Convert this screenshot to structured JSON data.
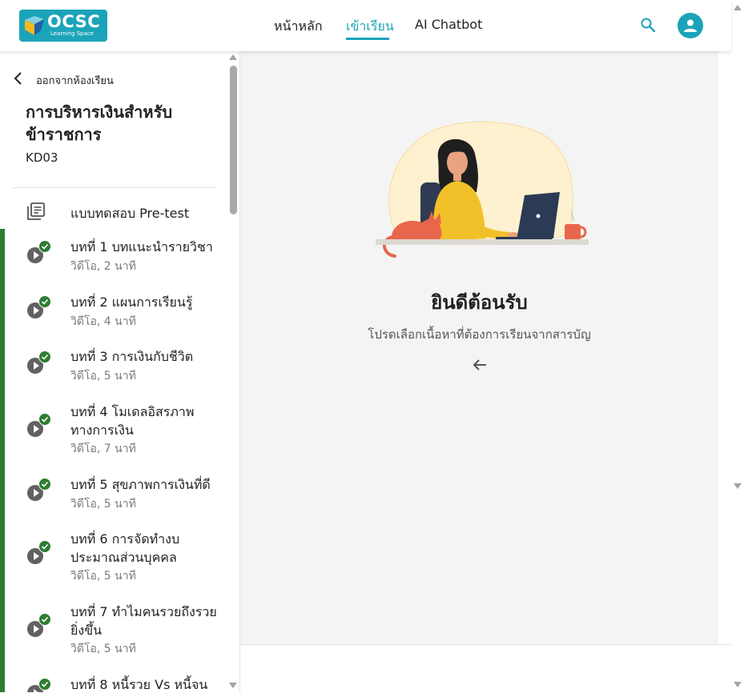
{
  "header": {
    "logo_text": "OCSC",
    "logo_subtext": "Learning Space",
    "nav": [
      {
        "label": "หน้าหลัก"
      },
      {
        "label": "เข้าเรียน"
      },
      {
        "label": "AI Chatbot"
      }
    ],
    "active_nav": "เข้าเรียน",
    "accent_color": "#1ba4b9"
  },
  "sidebar": {
    "back_label": "ออกจากห้องเรียน",
    "course_title": "การบริหารเงินสำหรับข้าราชการ",
    "course_code": "KD03",
    "pretest_label": "แบบทดสอบ Pre-test",
    "progress_color": "#2e7d32",
    "lessons": [
      {
        "title": "บทที่ 1 บทแนะนำรายวิชา",
        "meta": "วิดีโอ, 2 นาที",
        "completed": true
      },
      {
        "title": "บทที่ 2 แผนการเรียนรู้",
        "meta": "วิดีโอ, 4 นาที",
        "completed": true
      },
      {
        "title": "บทที่ 3 การเงินกับชีวิต",
        "meta": "วิดีโอ, 5 นาที",
        "completed": true
      },
      {
        "title": "บทที่ 4 โมเดลอิสรภาพทางการเงิน",
        "meta": "วิดีโอ, 7 นาที",
        "completed": true
      },
      {
        "title": "บทที่ 5 สุขภาพการเงินที่ดี",
        "meta": "วิดีโอ, 5 นาที",
        "completed": true
      },
      {
        "title": "บทที่ 6 การจัดทำงบประมาณส่วนบุคคล",
        "meta": "วิดีโอ, 5 นาที",
        "completed": true
      },
      {
        "title": "บทที่ 7 ทำไมคนรวยถึงรวยยิ่งขึ้น",
        "meta": "วิดีโอ, 5 นาที",
        "completed": true
      },
      {
        "title": "บทที่ 8 หนี้รวย Vs หนี้จน",
        "meta": "",
        "completed": true
      }
    ]
  },
  "main": {
    "welcome_title": "ยินดีต้อนรับ",
    "welcome_subtitle": "โปรดเลือกเนื้อหาที่ต้องการเรียนจากสารบัญ"
  }
}
